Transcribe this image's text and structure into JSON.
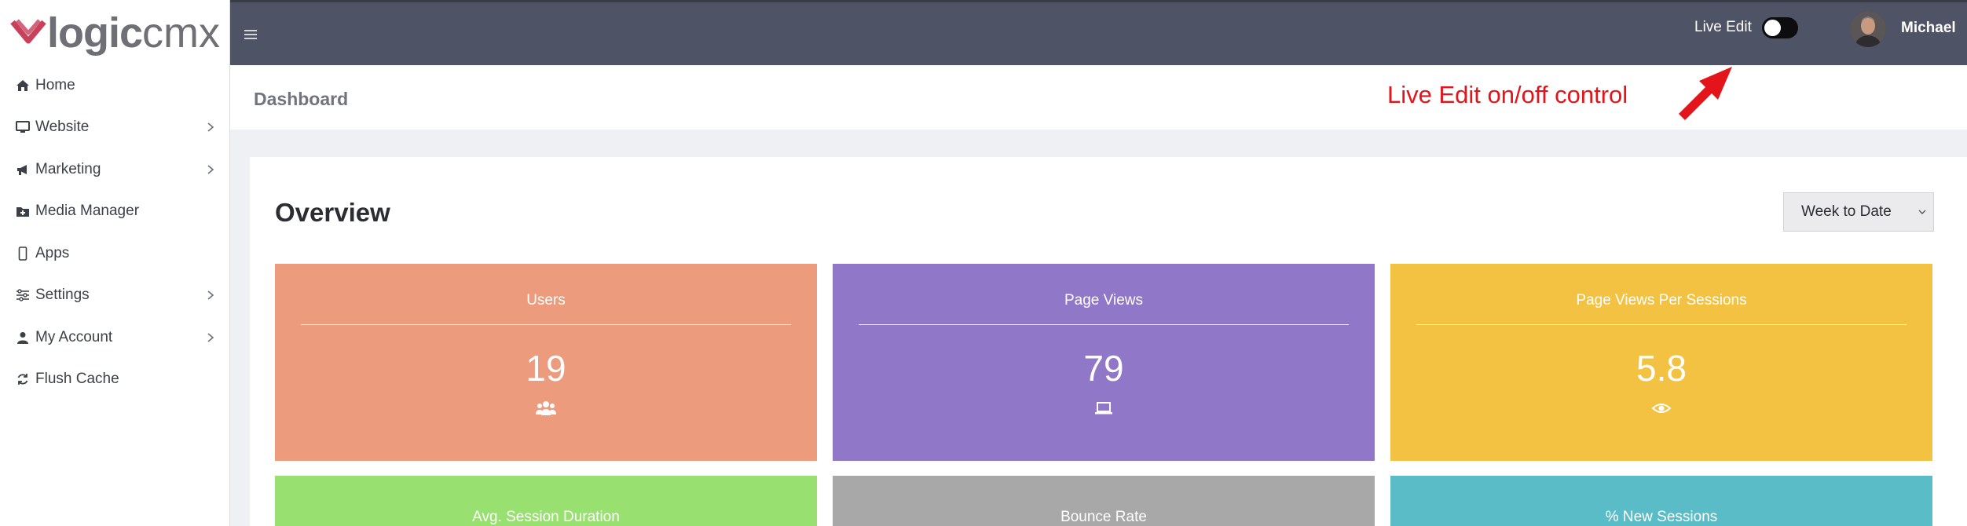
{
  "logo": {
    "bold": "logic",
    "light": "cmx"
  },
  "sidebar": {
    "items": [
      {
        "label": "Home",
        "icon": "home-icon",
        "has_chevron": false
      },
      {
        "label": "Website",
        "icon": "monitor-icon",
        "has_chevron": true
      },
      {
        "label": "Marketing",
        "icon": "megaphone-icon",
        "has_chevron": true
      },
      {
        "label": "Media Manager",
        "icon": "folder-plus-icon",
        "has_chevron": false
      },
      {
        "label": "Apps",
        "icon": "mobile-icon",
        "has_chevron": false
      },
      {
        "label": "Settings",
        "icon": "sliders-icon",
        "has_chevron": true
      },
      {
        "label": "My Account",
        "icon": "user-icon",
        "has_chevron": true
      },
      {
        "label": "Flush Cache",
        "icon": "refresh-icon",
        "has_chevron": false
      }
    ]
  },
  "topbar": {
    "live_edit_label": "Live Edit",
    "live_edit_on": false,
    "user_name": "Michael"
  },
  "header": {
    "title": "Dashboard"
  },
  "annotation": {
    "text": "Live Edit on/off control",
    "color": "#e4141b"
  },
  "overview": {
    "title": "Overview",
    "range_select": "Week to Date",
    "tiles": [
      {
        "title": "Users",
        "value": "19",
        "color": "#ec9b7d",
        "icon": "users-icon"
      },
      {
        "title": "Page Views",
        "value": "79",
        "color": "#9177c8",
        "icon": "laptop-icon"
      },
      {
        "title": "Page Views Per Sessions",
        "value": "5.8",
        "color": "#f3c242",
        "icon": "eye-icon"
      },
      {
        "title": "Avg. Session Duration",
        "value": "",
        "color": "#98e070",
        "icon": ""
      },
      {
        "title": "Bounce Rate",
        "value": "",
        "color": "#a8a8a8",
        "icon": ""
      },
      {
        "title": "% New Sessions",
        "value": "",
        "color": "#5abcc6",
        "icon": ""
      }
    ]
  }
}
